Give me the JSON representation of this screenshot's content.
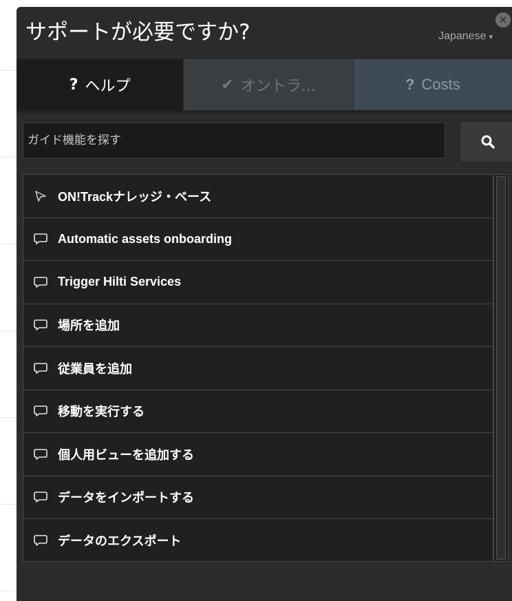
{
  "header": {
    "title": "サポートが必要ですか?",
    "language": "Japanese",
    "language_caret": "▾",
    "close_icon": "close-icon"
  },
  "tabs": [
    {
      "glyph": "?",
      "label": "ヘルプ",
      "icon": "question-icon",
      "active": true
    },
    {
      "glyph": "✔",
      "label": "オントラ...",
      "icon": "check-icon",
      "active": false
    },
    {
      "glyph": "?",
      "label": "Costs",
      "icon": "question-icon",
      "active": false
    }
  ],
  "search": {
    "placeholder": "ガイド機能を探す",
    "value": "",
    "button_icon": "search-icon"
  },
  "items": [
    {
      "label": "ON!Trackナレッジ・ベース",
      "icon": "pointer-icon"
    },
    {
      "label": "Automatic assets onboarding",
      "icon": "chat-bubble-icon"
    },
    {
      "label": "Trigger Hilti Services",
      "icon": "chat-bubble-icon"
    },
    {
      "label": "場所を追加",
      "icon": "chat-bubble-icon"
    },
    {
      "label": "従業員を追加",
      "icon": "chat-bubble-icon"
    },
    {
      "label": "移動を実行する",
      "icon": "chat-bubble-icon"
    },
    {
      "label": "個人用ビューを追加する",
      "icon": "chat-bubble-icon"
    },
    {
      "label": "データをインポートする",
      "icon": "chat-bubble-icon"
    },
    {
      "label": "データのエクスポート",
      "icon": "chat-bubble-icon"
    }
  ],
  "colors": {
    "panel_bg": "#2b2b2b",
    "active_tab_bg": "#1c1c1c",
    "inactive_tab_bg": "#3b3f44",
    "costs_tab_bg": "#3e4b56",
    "text": "#ffffff"
  }
}
